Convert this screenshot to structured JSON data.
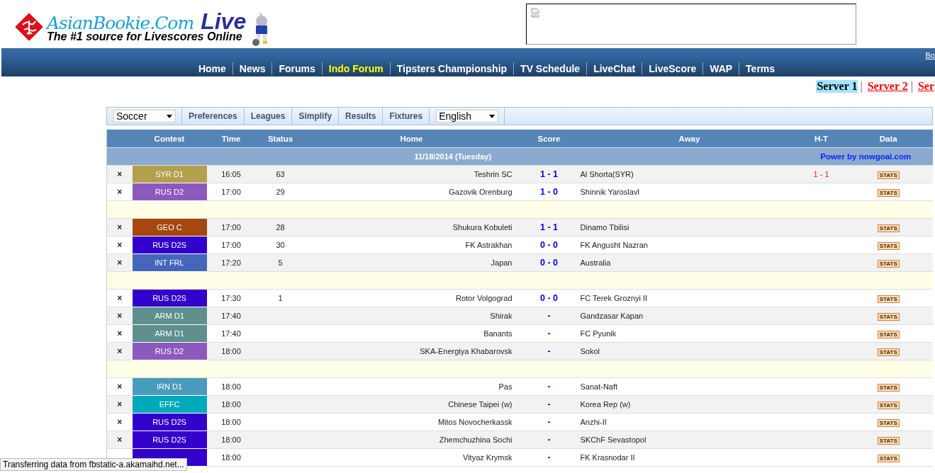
{
  "header": {
    "logo_title": "AsianBookie.Com",
    "logo_live": "Live",
    "tagline": "The #1 source for Livescores Online"
  },
  "nav": {
    "corner_link": "Bo",
    "items": [
      {
        "label": "Home",
        "selected": false
      },
      {
        "label": "News",
        "selected": false
      },
      {
        "label": "Forums",
        "selected": false
      },
      {
        "label": "Indo Forum",
        "selected": true
      },
      {
        "label": "Tipsters Championship",
        "selected": false
      },
      {
        "label": "TV Schedule",
        "selected": false
      },
      {
        "label": "LiveChat",
        "selected": false
      },
      {
        "label": "LiveScore",
        "selected": false
      },
      {
        "label": "WAP",
        "selected": false
      },
      {
        "label": "Terms",
        "selected": false
      }
    ]
  },
  "servers": [
    {
      "label": "Server 1",
      "selected": true,
      "separator": "|"
    },
    {
      "label": "Server 2",
      "selected": false,
      "separator": "|"
    },
    {
      "label": "Ser",
      "selected": false
    }
  ],
  "toolbar": {
    "sport": "Soccer",
    "buttons": [
      "Preferences",
      "Leagues",
      "Simplify",
      "Results",
      "Fixtures"
    ],
    "language": "English"
  },
  "table": {
    "columns": [
      "Contest",
      "Time",
      "Status",
      "Home",
      "Score",
      "Away",
      "H-T",
      "Data"
    ],
    "date": "11/18/2014 (Tuesday)",
    "credit": "Power by nowgoal.com",
    "rows": [
      {
        "kind": "match",
        "remove": "×",
        "contest": "SYR D1",
        "color": "#b3a04f",
        "time": "16:05",
        "status": "63",
        "home": "Teshrin SC",
        "score": "1 - 1",
        "away": "Al Shorta(SYR)",
        "ht": "1 - 1",
        "data": "STATS"
      },
      {
        "kind": "match",
        "remove": "×",
        "contest": "RUS D2",
        "color": "#8e59bf",
        "time": "17:00",
        "status": "29",
        "home": "Gazovik Orenburg",
        "score": "1 - 0",
        "away": "Shinnik Yaroslavl",
        "data": "STATS"
      },
      {
        "kind": "spacer"
      },
      {
        "kind": "match",
        "remove": "×",
        "contest": "GEO C",
        "color": "#a5470f",
        "time": "17:00",
        "status": "28",
        "home": "Shukura Kobuleti",
        "score": "1 - 1",
        "away": "Dinamo Tbilisi",
        "data": "STATS"
      },
      {
        "kind": "match",
        "remove": "×",
        "contest": "RUS D2S",
        "color": "#3300cc",
        "time": "17:00",
        "status": "30",
        "home": "FK Astrakhan",
        "score": "0 - 0",
        "away": "FK Angusht Nazran",
        "data": "STATS"
      },
      {
        "kind": "match",
        "remove": "×",
        "contest": "INT FRL",
        "color": "#4466bb",
        "time": "17:20",
        "status": "5",
        "home": "Japan",
        "score": "0 - 0",
        "away": "Australia",
        "data": "STATS"
      },
      {
        "kind": "spacer"
      },
      {
        "kind": "match",
        "remove": "×",
        "contest": "RUS D2S",
        "color": "#3300cc",
        "time": "17:30",
        "status": "1",
        "home": "Rotor Volgograd",
        "score": "0 - 0",
        "away": "FC Terek Groznyi II",
        "data": "STATS"
      },
      {
        "kind": "match",
        "remove": "×",
        "contest": "ARM D1",
        "color": "#5f908e",
        "time": "17:40",
        "home": "Shirak",
        "score": "-",
        "away": "Gandzasar Kapan",
        "data": "STATS"
      },
      {
        "kind": "match",
        "remove": "×",
        "contest": "ARM D1",
        "color": "#5f908e",
        "time": "17:40",
        "home": "Banants",
        "score": "-",
        "away": "FC Pyunik",
        "data": "STATS"
      },
      {
        "kind": "match",
        "remove": "×",
        "contest": "RUS D2",
        "color": "#8e59bf",
        "time": "18:00",
        "home": "SKA-Energiya Khabarovsk",
        "score": "-",
        "away": "Sokol",
        "data": "STATS"
      },
      {
        "kind": "spacer"
      },
      {
        "kind": "match",
        "remove": "×",
        "contest": "IRN D1",
        "color": "#4a9bbd",
        "time": "18:00",
        "home": "Pas",
        "score": "-",
        "away": "Sanat-Naft",
        "data": "STATS"
      },
      {
        "kind": "match",
        "remove": "×",
        "contest": "EFFC",
        "color": "#00a9b9",
        "time": "18:00",
        "home": "Chinese Taipei (w)",
        "score": "-",
        "away": "Korea Rep (w)",
        "data": "STATS"
      },
      {
        "kind": "match",
        "remove": "×",
        "contest": "RUS D2S",
        "color": "#3300cc",
        "time": "18:00",
        "home": "Mitos Novocherkassk",
        "score": "-",
        "away": "Anzhi-II",
        "data": "STATS"
      },
      {
        "kind": "match",
        "remove": "×",
        "contest": "RUS D2S",
        "color": "#3300cc",
        "time": "18:00",
        "home": "Zhemchuzhina Sochi",
        "score": "-",
        "away": "SKChF Sevastopol",
        "data": "STATS"
      },
      {
        "kind": "match",
        "color": "#3300cc",
        "time": "18:00",
        "home": "Vityaz Krymsk",
        "score": "-",
        "away": "FK Krasnodar II",
        "data": "STATS"
      }
    ]
  },
  "status_bar": "Transferring data from fbstatic-a.akamaihd.net..."
}
